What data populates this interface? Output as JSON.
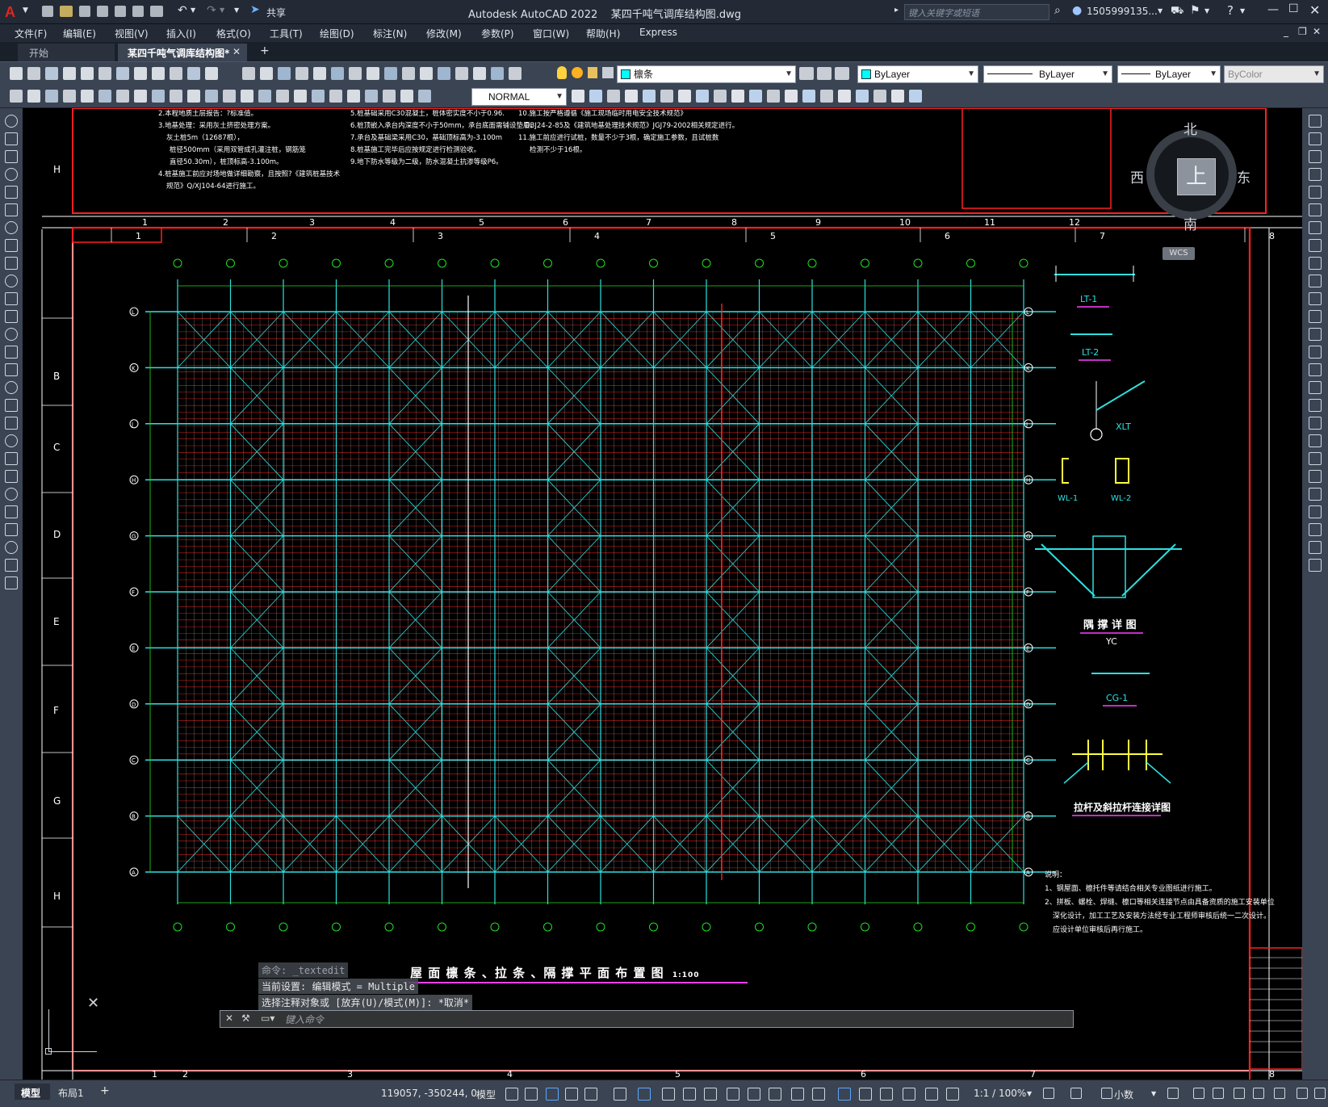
{
  "titlebar": {
    "app_title": "Autodesk AutoCAD 2022",
    "file_title": "某四千吨气调库结构图.dwg",
    "search_placeholder": "键入关键字或短语",
    "user": "1505999135...",
    "share": "共享"
  },
  "menu": [
    "文件(F)",
    "编辑(E)",
    "视图(V)",
    "插入(I)",
    "格式(O)",
    "工具(T)",
    "绘图(D)",
    "标注(N)",
    "修改(M)",
    "参数(P)",
    "窗口(W)",
    "帮助(H)",
    "Express"
  ],
  "tabs": [
    {
      "label": "开始"
    },
    {
      "label": "某四千吨气调库结构图*"
    }
  ],
  "toolbar": {
    "layer_value": "檩条",
    "color_value": "ByLayer",
    "linetype_value": "ByLayer",
    "lineweight_value": "ByLayer",
    "plotstyle_value": "ByColor",
    "dimstyle_value": "NORMAL"
  },
  "colors": {
    "accent": "#2a7fd4",
    "layer_swatch": "#00ffff",
    "drawing_red": "#ff2020",
    "drawing_cyan": "#2ee0e0",
    "drawing_green": "#20e020",
    "drawing_white": "#ffffff",
    "drawing_magenta": "#ff40ff"
  },
  "viewcube": {
    "north": "北",
    "south": "南",
    "east": "东",
    "west": "西",
    "top": "上",
    "wcs": "WCS"
  },
  "drawing": {
    "title": "屋 面 檩 条 、拉 条 、隔 撑 平 面 布 置 图",
    "title_scale": "1:100",
    "row_labels_left": [
      "H",
      "B",
      "C",
      "D",
      "E",
      "F",
      "G",
      "H"
    ],
    "col_numbers_top": [
      "1",
      "2",
      "3",
      "4",
      "5",
      "6",
      "7",
      "8",
      "9",
      "10",
      "11",
      "12"
    ],
    "col_numbers_mid": [
      "1",
      "2",
      "3",
      "4",
      "5",
      "6",
      "7",
      "8"
    ],
    "col_numbers_bottom": [
      "1",
      "2",
      "3",
      "4",
      "5",
      "6",
      "7",
      "8"
    ],
    "grid_letters": [
      "L",
      "K",
      "J",
      "H",
      "G",
      "F",
      "E",
      "D",
      "C",
      "B",
      "A"
    ],
    "detail_labels": [
      "LT-1",
      "LT-2",
      "XLT",
      "WL-1",
      "WL-2",
      "隅 撑 详 图",
      "YC",
      "CG-1",
      "拉杆及斜拉杆连接详图"
    ],
    "notes_title": "说明：",
    "notes": [
      "1、钢屋面、檩托件等请结合相关专业图纸进行施工。",
      "2、拼板、螺栓、焊缝、檩口等相关连接节点由具备资质的施工安装单位",
      "深化设计，加工工艺及安装方法经专业工程师审核后统一二次设计。",
      "应设计单位审核后再行施工。"
    ],
    "top_notes": [
      "2.本程地质土层报告：?标准值。",
      "3.地基处理：采用灰土挤密处理方案。",
      "灰土桩5m（12687根），",
      "桩径500mm（采用双管成孔灌注桩，钢筋笼",
      "直径50.30m），桩顶标高-3.100m。",
      "4.桩基施工前应对场地做详细勘察，且按照?《建筑桩基技术",
      "规范》Q/XJ104-64进行施工。",
      "5.桩基础采用C30混凝土，桩体密实度不小于0.96.",
      "6.桩顶嵌入承台内深度不小于50mm，承台底面需铺设垫层。",
      "7.承台及基础梁采用C30，基础顶标高为-3.100m",
      "8.桩基施工完毕后应按规定进行检测验收。",
      "9.地下防水等级为二级，防水混凝土抗渗等级P6。",
      "10.施工按严格遵循《施工现场临时用电安全技术规范》",
      "DBJ24-2-85及《建筑地基处理技术规范》JGJ79-2002相关规定进行。",
      "11.施工前应进行试桩，数量不少于3根，确定施工参数，且试桩数",
      "检测不少于16根。"
    ]
  },
  "command": {
    "history": [
      "命令: _textedit",
      "当前设置: 编辑模式 = Multiple",
      "选择注释对象或 [放弃(U)/模式(M)]: *取消*"
    ],
    "placeholder": "键入命令"
  },
  "status": {
    "layout_tabs": [
      "模型",
      "布局1"
    ],
    "coords": "119057, -350244, 0",
    "space": "模型",
    "scale": "1:1 / 100%",
    "units": "小数"
  }
}
